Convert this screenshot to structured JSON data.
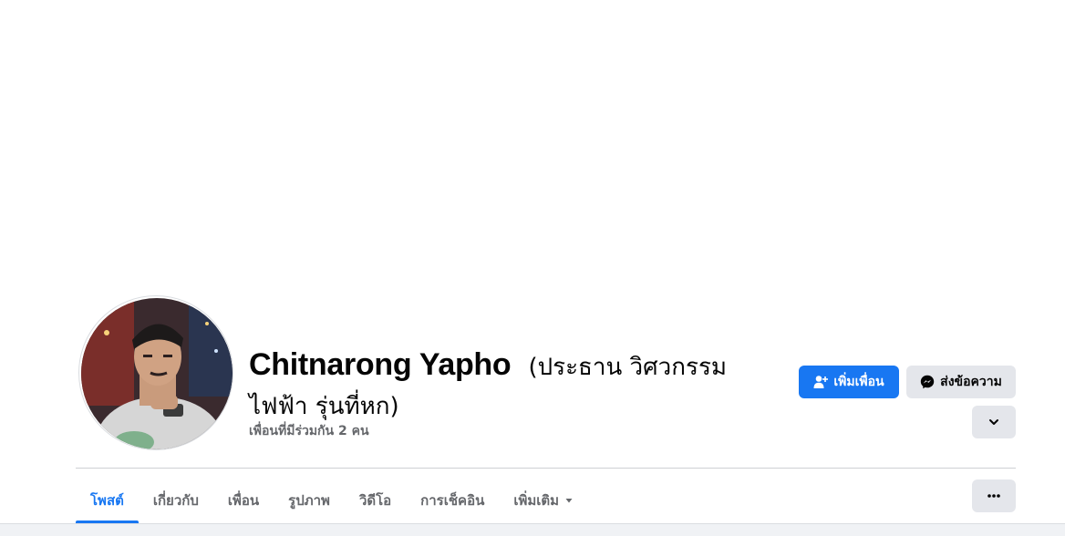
{
  "profile": {
    "name": "Chitnarong Yapho",
    "alternate_name": "(ประธาน วิศวกรรมไฟฟ้า รุ่นที่หก)",
    "mutual_friends": "เพื่อนที่มีร่วมกัน 2 คน"
  },
  "actions": {
    "add_friend_label": "เพิ่มเพื่อน",
    "message_label": "ส่งข้อความ"
  },
  "tabs": [
    {
      "label": "โพสต์",
      "active": true
    },
    {
      "label": "เกี่ยวกับ",
      "active": false
    },
    {
      "label": "เพื่อน",
      "active": false
    },
    {
      "label": "รูปภาพ",
      "active": false
    },
    {
      "label": "วิดีโอ",
      "active": false
    },
    {
      "label": "การเช็คอิน",
      "active": false
    },
    {
      "label": "เพิ่มเติม",
      "active": false
    }
  ],
  "colors": {
    "accent": "#1877f2",
    "secondary_button": "#e4e6eb",
    "muted_text": "#65676b"
  },
  "icons": [
    "add-friend-icon",
    "messenger-icon",
    "chevron-down-icon",
    "caret-down-icon",
    "more-dots-icon"
  ]
}
